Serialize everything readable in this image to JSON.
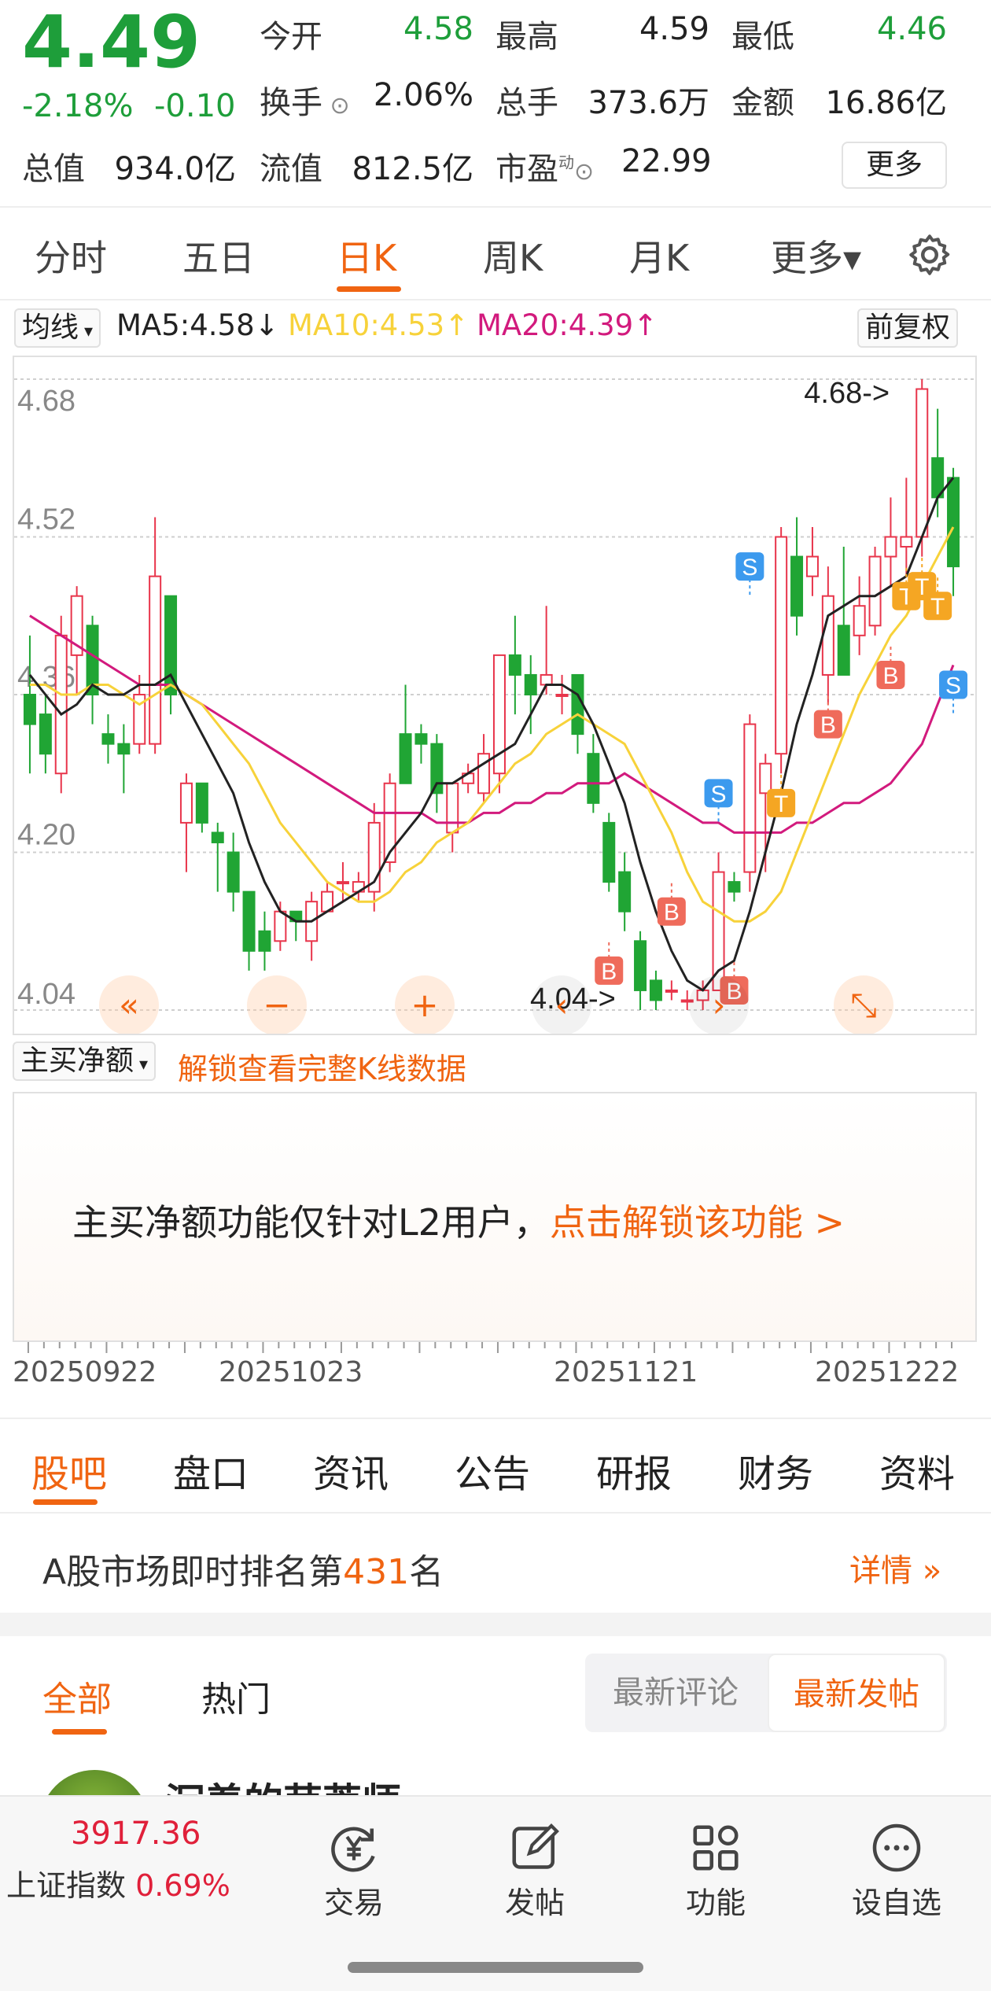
{
  "quote": {
    "price": "4.49",
    "change_pct": "-2.18%",
    "change_abs": "-0.10",
    "market_cap_label": "总值",
    "market_cap": "934.0亿",
    "open_label": "今开",
    "open": "4.58",
    "high_label": "最高",
    "high": "4.59",
    "low_label": "最低",
    "low": "4.46",
    "turnover_label": "换手",
    "turnover": "2.06%",
    "volume_label": "总手",
    "volume": "373.6万",
    "amount_label": "金额",
    "amount": "16.86亿",
    "float_cap_label": "流值",
    "float_cap": "812.5亿",
    "pe_label": "市盈",
    "pe_superscript": "动",
    "pe": "22.99",
    "more_button": "更多",
    "down_color": "#1e9e3a"
  },
  "period_tabs": [
    "分时",
    "五日",
    "日K",
    "周K",
    "月K",
    "更多▾"
  ],
  "active_period": "日K",
  "ma_row": {
    "indicator_select": "均线",
    "ma5": "MA5:4.58",
    "ma5_arrow": "↓",
    "ma10": "MA10:4.53",
    "ma10_arrow": "↑",
    "ma20": "MA20:4.39",
    "ma20_arrow": "↑",
    "adjust": "前复权",
    "ma5_color": "#222222",
    "ma10_color": "#f7d23a",
    "ma20_color": "#d21a7d"
  },
  "chart_data": {
    "type": "candlestick",
    "y_ticks": [
      "4.68",
      "4.52",
      "4.36",
      "4.20",
      "4.04"
    ],
    "ylim": [
      4.04,
      4.68
    ],
    "max_label": "4.68->",
    "min_label": "4.04->",
    "x_ticks": [
      "20250922",
      "20251023",
      "20251121",
      "20251222"
    ],
    "up_color": "#e8354b",
    "down_color": "#20a534",
    "candles": [
      {
        "o": 4.36,
        "h": 4.42,
        "l": 4.28,
        "c": 4.33
      },
      {
        "o": 4.34,
        "h": 4.36,
        "l": 4.28,
        "c": 4.3
      },
      {
        "o": 4.28,
        "h": 4.44,
        "l": 4.26,
        "c": 4.42
      },
      {
        "o": 4.4,
        "h": 4.47,
        "l": 4.36,
        "c": 4.46
      },
      {
        "o": 4.43,
        "h": 4.44,
        "l": 4.33,
        "c": 4.36
      },
      {
        "o": 4.32,
        "h": 4.34,
        "l": 4.29,
        "c": 4.31
      },
      {
        "o": 4.31,
        "h": 4.33,
        "l": 4.26,
        "c": 4.3
      },
      {
        "o": 4.31,
        "h": 4.38,
        "l": 4.3,
        "c": 4.36
      },
      {
        "o": 4.31,
        "h": 4.54,
        "l": 4.3,
        "c": 4.48
      },
      {
        "o": 4.46,
        "h": 4.46,
        "l": 4.34,
        "c": 4.36
      },
      {
        "o": 4.23,
        "h": 4.28,
        "l": 4.18,
        "c": 4.27
      },
      {
        "o": 4.27,
        "h": 4.27,
        "l": 4.22,
        "c": 4.23
      },
      {
        "o": 4.22,
        "h": 4.23,
        "l": 4.16,
        "c": 4.21
      },
      {
        "o": 4.2,
        "h": 4.22,
        "l": 4.14,
        "c": 4.16
      },
      {
        "o": 4.16,
        "h": 4.16,
        "l": 4.08,
        "c": 4.1
      },
      {
        "o": 4.12,
        "h": 4.14,
        "l": 4.08,
        "c": 4.1
      },
      {
        "o": 4.11,
        "h": 4.15,
        "l": 4.1,
        "c": 4.14
      },
      {
        "o": 4.14,
        "h": 4.14,
        "l": 4.11,
        "c": 4.13
      },
      {
        "o": 4.11,
        "h": 4.16,
        "l": 4.09,
        "c": 4.15
      },
      {
        "o": 4.14,
        "h": 4.17,
        "l": 4.14,
        "c": 4.16
      },
      {
        "o": 4.17,
        "h": 4.19,
        "l": 4.15,
        "c": 4.17
      },
      {
        "o": 4.16,
        "h": 4.18,
        "l": 4.15,
        "c": 4.17
      },
      {
        "o": 4.16,
        "h": 4.25,
        "l": 4.14,
        "c": 4.23
      },
      {
        "o": 4.19,
        "h": 4.28,
        "l": 4.18,
        "c": 4.27
      },
      {
        "o": 4.32,
        "h": 4.37,
        "l": 4.27,
        "c": 4.27
      },
      {
        "o": 4.32,
        "h": 4.33,
        "l": 4.29,
        "c": 4.31
      },
      {
        "o": 4.31,
        "h": 4.32,
        "l": 4.24,
        "c": 4.26
      },
      {
        "o": 4.22,
        "h": 4.27,
        "l": 4.2,
        "c": 4.27
      },
      {
        "o": 4.27,
        "h": 4.29,
        "l": 4.26,
        "c": 4.28
      },
      {
        "o": 4.26,
        "h": 4.32,
        "l": 4.25,
        "c": 4.3
      },
      {
        "o": 4.28,
        "h": 4.4,
        "l": 4.26,
        "c": 4.4
      },
      {
        "o": 4.4,
        "h": 4.44,
        "l": 4.34,
        "c": 4.38
      },
      {
        "o": 4.38,
        "h": 4.4,
        "l": 4.32,
        "c": 4.36
      },
      {
        "o": 4.37,
        "h": 4.45,
        "l": 4.36,
        "c": 4.38
      },
      {
        "o": 4.36,
        "h": 4.38,
        "l": 4.34,
        "c": 4.36
      },
      {
        "o": 4.38,
        "h": 4.38,
        "l": 4.3,
        "c": 4.32
      },
      {
        "o": 4.3,
        "h": 4.32,
        "l": 4.24,
        "c": 4.25
      },
      {
        "o": 4.23,
        "h": 4.24,
        "l": 4.16,
        "c": 4.17
      },
      {
        "o": 4.18,
        "h": 4.2,
        "l": 4.12,
        "c": 4.14
      },
      {
        "o": 4.11,
        "h": 4.12,
        "l": 4.04,
        "c": 4.06
      },
      {
        "o": 4.07,
        "h": 4.08,
        "l": 4.04,
        "c": 4.05
      },
      {
        "o": 4.06,
        "h": 4.07,
        "l": 4.05,
        "c": 4.06
      },
      {
        "o": 4.05,
        "h": 4.06,
        "l": 4.04,
        "c": 4.05
      },
      {
        "o": 4.05,
        "h": 4.07,
        "l": 4.04,
        "c": 4.06
      },
      {
        "o": 4.06,
        "h": 4.2,
        "l": 4.06,
        "c": 4.18
      },
      {
        "o": 4.17,
        "h": 4.18,
        "l": 4.15,
        "c": 4.16
      },
      {
        "o": 4.18,
        "h": 4.34,
        "l": 4.16,
        "c": 4.33
      },
      {
        "o": 4.26,
        "h": 4.3,
        "l": 4.18,
        "c": 4.29
      },
      {
        "o": 4.3,
        "h": 4.53,
        "l": 4.28,
        "c": 4.52
      },
      {
        "o": 4.5,
        "h": 4.54,
        "l": 4.42,
        "c": 4.44
      },
      {
        "o": 4.48,
        "h": 4.53,
        "l": 4.46,
        "c": 4.5
      },
      {
        "o": 4.38,
        "h": 4.49,
        "l": 4.35,
        "c": 4.46
      },
      {
        "o": 4.43,
        "h": 4.51,
        "l": 4.38,
        "c": 4.38
      },
      {
        "o": 4.42,
        "h": 4.48,
        "l": 4.4,
        "c": 4.45
      },
      {
        "o": 4.43,
        "h": 4.51,
        "l": 4.42,
        "c": 4.5
      },
      {
        "o": 4.5,
        "h": 4.56,
        "l": 4.47,
        "c": 4.52
      },
      {
        "o": 4.51,
        "h": 4.58,
        "l": 4.48,
        "c": 4.52
      },
      {
        "o": 4.52,
        "h": 4.68,
        "l": 4.5,
        "c": 4.67
      },
      {
        "o": 4.6,
        "h": 4.65,
        "l": 4.54,
        "c": 4.56
      },
      {
        "o": 4.58,
        "h": 4.59,
        "l": 4.46,
        "c": 4.49
      }
    ],
    "ma5": [
      4.38,
      4.36,
      4.34,
      4.35,
      4.37,
      4.36,
      4.36,
      4.37,
      4.37,
      4.38,
      4.35,
      4.32,
      4.29,
      4.26,
      4.21,
      4.17,
      4.14,
      4.13,
      4.13,
      4.14,
      4.15,
      4.16,
      4.17,
      4.2,
      4.22,
      4.24,
      4.27,
      4.27,
      4.28,
      4.29,
      4.3,
      4.31,
      4.34,
      4.37,
      4.37,
      4.36,
      4.33,
      4.29,
      4.25,
      4.19,
      4.14,
      4.1,
      4.07,
      4.06,
      4.08,
      4.09,
      4.14,
      4.2,
      4.26,
      4.33,
      4.38,
      4.44,
      4.45,
      4.46,
      4.46,
      4.47,
      4.48,
      4.52,
      4.56,
      4.58
    ],
    "ma10": [
      4.37,
      4.37,
      4.36,
      4.36,
      4.37,
      4.37,
      4.36,
      4.35,
      4.36,
      4.37,
      4.36,
      4.35,
      4.33,
      4.31,
      4.29,
      4.26,
      4.23,
      4.21,
      4.19,
      4.17,
      4.16,
      4.15,
      4.15,
      4.16,
      4.18,
      4.19,
      4.21,
      4.22,
      4.23,
      4.25,
      4.27,
      4.29,
      4.3,
      4.32,
      4.33,
      4.34,
      4.33,
      4.32,
      4.31,
      4.28,
      4.25,
      4.22,
      4.18,
      4.15,
      4.14,
      4.13,
      4.13,
      4.14,
      4.16,
      4.2,
      4.24,
      4.28,
      4.32,
      4.36,
      4.39,
      4.42,
      4.44,
      4.47,
      4.5,
      4.53
    ],
    "ma20": [
      4.44,
      4.43,
      4.42,
      4.41,
      4.4,
      4.39,
      4.38,
      4.37,
      4.37,
      4.37,
      4.36,
      4.35,
      4.34,
      4.33,
      4.32,
      4.31,
      4.3,
      4.29,
      4.28,
      4.27,
      4.26,
      4.25,
      4.24,
      4.24,
      4.24,
      4.24,
      4.23,
      4.23,
      4.23,
      4.24,
      4.24,
      4.25,
      4.25,
      4.26,
      4.26,
      4.27,
      4.27,
      4.27,
      4.28,
      4.27,
      4.26,
      4.25,
      4.24,
      4.23,
      4.23,
      4.22,
      4.22,
      4.22,
      4.22,
      4.23,
      4.23,
      4.24,
      4.25,
      4.25,
      4.26,
      4.27,
      4.29,
      4.31,
      4.35,
      4.39
    ],
    "signals": [
      {
        "i": 37,
        "t": "B",
        "v": 4.08
      },
      {
        "i": 41,
        "t": "B",
        "v": 4.14
      },
      {
        "i": 45,
        "t": "B",
        "v": 4.06
      },
      {
        "i": 44,
        "t": "S",
        "v": 4.26
      },
      {
        "i": 46,
        "t": "S",
        "v": 4.49
      },
      {
        "i": 48,
        "t": "T",
        "v": 4.25
      },
      {
        "i": 51,
        "t": "B",
        "v": 4.33
      },
      {
        "i": 55,
        "t": "B",
        "v": 4.38
      },
      {
        "i": 56,
        "t": "T",
        "v": 4.46
      },
      {
        "i": 57,
        "t": "T",
        "v": 4.47
      },
      {
        "i": 58,
        "t": "T",
        "v": 4.45
      },
      {
        "i": 59,
        "t": "S",
        "v": 4.37
      }
    ],
    "controls": [
      "«",
      "−",
      "+",
      "‹",
      "›",
      "⤡"
    ]
  },
  "sub_chart": {
    "select": "主买净额",
    "unlock_hint": "解锁查看完整K线数据",
    "l2_text": "主买净额功能仅针对L2用户，",
    "l2_link": "点击解锁该功能 >"
  },
  "bottom_tabs": [
    "股吧",
    "盘口",
    "资讯",
    "公告",
    "研报",
    "财务",
    "资料"
  ],
  "active_bottom_tab": "股吧",
  "rank": {
    "prefix": "A股市场即时排名第",
    "number": "431",
    "suffix": "名",
    "detail": "详情"
  },
  "feed": {
    "tabs": [
      "全部",
      "热门"
    ],
    "sort_options": [
      "最新评论",
      "最新发帖"
    ],
    "active_sort": "最新发帖",
    "post_title": "沉着的苹萃师"
  },
  "dock": {
    "index_value": "3917.36",
    "index_name": "上证指数",
    "index_change": "0.69%",
    "items": [
      "交易",
      "发帖",
      "功能",
      "设自选"
    ]
  },
  "accent": "#f06411"
}
